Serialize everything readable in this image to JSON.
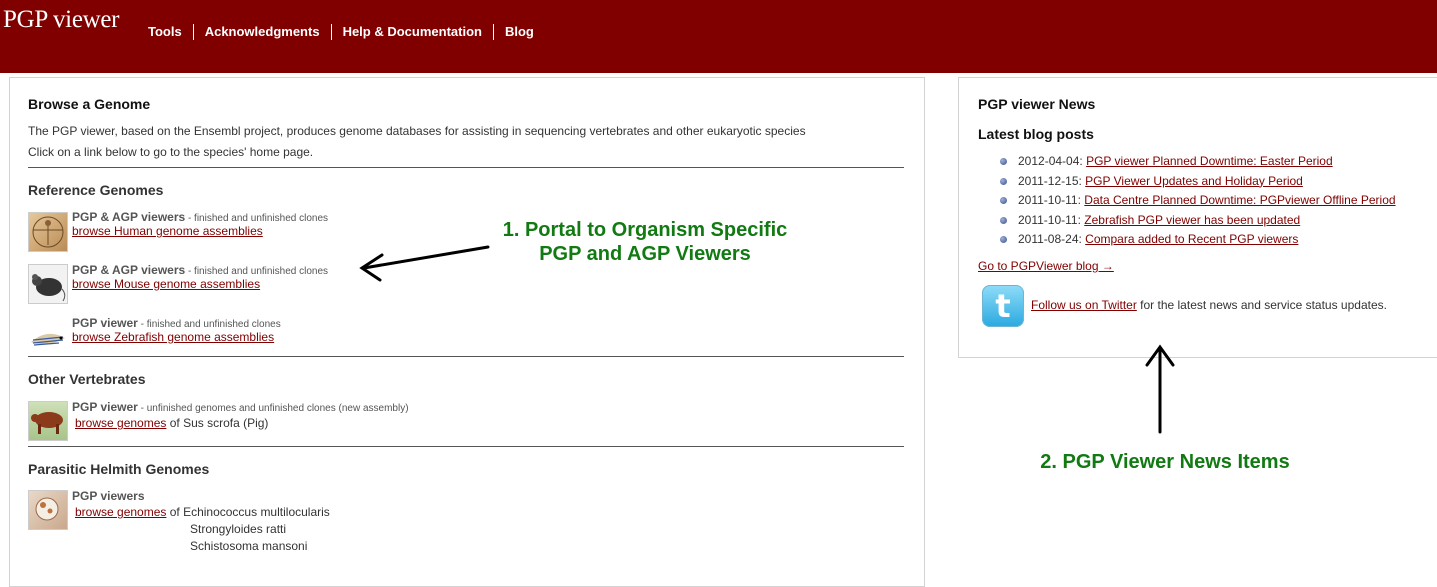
{
  "header": {
    "logo": "PGP viewer",
    "nav": [
      "Tools",
      "Acknowledgments",
      "Help & Documentation",
      "Blog"
    ]
  },
  "browse": {
    "title": "Browse a Genome",
    "intro1": "The PGP viewer, based on the Ensembl project, produces genome databases for assisting in sequencing vertebrates and other eukaryotic species",
    "intro2": "Click on a link below to go to the species' home page.",
    "sections": {
      "reference": "Reference Genomes",
      "other": "Other Vertebrates",
      "parasitic": "Parasitic Helmith Genomes"
    },
    "human": {
      "title": "PGP & AGP viewers",
      "desc": " - finished and unfinished clones",
      "link": "browse Human genome assemblies"
    },
    "mouse": {
      "title": "PGP & AGP viewers",
      "desc": " - finished and unfinished clones",
      "link": "browse Mouse genome assemblies"
    },
    "zebrafish": {
      "title": "PGP viewer",
      "desc": " - finished and unfinished clones",
      "link": "browse Zebrafish genome assemblies"
    },
    "pig": {
      "title": "PGP viewer",
      "desc": " - unfinished genomes and unfinished clones (new assembly)",
      "link": "browse genomes",
      "suffix": " of Sus scrofa (Pig)"
    },
    "helminth": {
      "title": "PGP viewers",
      "link": "browse genomes",
      "suffix": " of Echinococcus multilocularis",
      "species2": "Strongyloides ratti",
      "species3": "Schistosoma mansoni"
    }
  },
  "news": {
    "title": "PGP viewer News",
    "subtitle": "Latest blog posts",
    "items": [
      {
        "date": "2012-04-04: ",
        "title": "PGP viewer Planned Downtime: Easter Period"
      },
      {
        "date": "2011-12-15: ",
        "title": "PGP Viewer Updates and Holiday Period"
      },
      {
        "date": "2011-10-11: ",
        "title": "Data Centre Planned Downtime: PGPviewer Offline Period"
      },
      {
        "date": "2011-10-11: ",
        "title": "Zebrafish PGP viewer has been updated"
      },
      {
        "date": "2011-08-24: ",
        "title": "Compara added to Recent PGP viewers"
      }
    ],
    "blog_link": "Go to PGPViewer blog →",
    "twitter_link": "Follow us on Twitter",
    "twitter_text": " for the latest news and service status updates."
  },
  "annotations": {
    "a1_line1": "1. Portal to Organism Specific",
    "a1_line2": "PGP and AGP Viewers",
    "a2": "2. PGP Viewer News Items"
  },
  "colors": {
    "header_bg": "#800000",
    "link": "#800000",
    "annotation": "#127a12"
  }
}
